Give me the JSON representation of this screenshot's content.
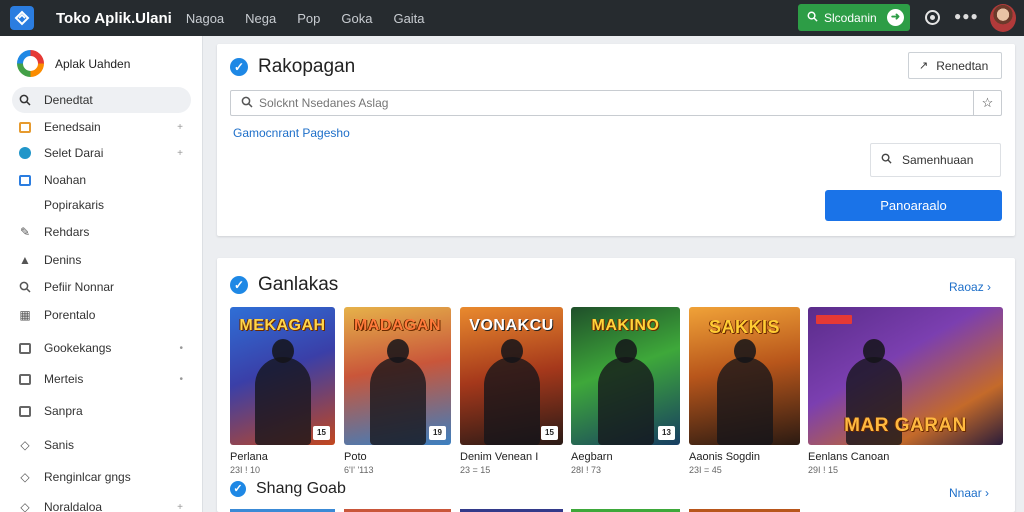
{
  "app": {
    "title": "Toko Aplik.Ulani"
  },
  "topnav": [
    "Nagoa",
    "Nega",
    "Pop",
    "Goka",
    "Gaita"
  ],
  "top_search_label": "Slcodanin",
  "sidebar": {
    "brand": "Aplak Uahden",
    "items": [
      {
        "label": "Denedtat",
        "icon": "search-icon"
      },
      {
        "label": "Eenedsain",
        "icon": "folder-icon",
        "trail": "+"
      },
      {
        "label": "Selet Darai",
        "icon": "circle-icon",
        "trail": "+"
      },
      {
        "label": "Noahan",
        "icon": "grid-icon"
      },
      {
        "label": "Popirakaris",
        "icon": ""
      },
      {
        "label": "Rehdars",
        "icon": "wrench-icon"
      },
      {
        "label": "Denins",
        "icon": "bell-icon"
      },
      {
        "label": "Pefiir Nonnar",
        "icon": "search-icon"
      },
      {
        "label": "Porentalo",
        "icon": "grid-icon"
      },
      {
        "label": "Gookekangs",
        "icon": "calendar-icon",
        "trail": "•"
      },
      {
        "label": "Merteis",
        "icon": "window-icon",
        "trail": "•"
      },
      {
        "label": "Sanpra",
        "icon": "image-icon"
      },
      {
        "label": "Sanis",
        "icon": "chat-icon"
      },
      {
        "label": "Renginlcar gngs",
        "icon": "chat-icon"
      },
      {
        "label": "Noraldaloa",
        "icon": "chat-icon",
        "trail": "+"
      }
    ]
  },
  "search_card": {
    "title": "Rakopagan",
    "header_button": "Renedtan",
    "search_placeholder": "Solcknt Nsedanes Aslag",
    "link": "Gamocnrant Pagesho",
    "secondary_button": "Samenhuaan",
    "primary_button": "Panoaraalo"
  },
  "games_card": {
    "title": "Ganlakas",
    "see_more": "Raoaz",
    "items": [
      {
        "title_art": "MEKAGAH",
        "name": "Perlana",
        "meta": "23I ! 10",
        "rating": "15"
      },
      {
        "title_art": "MADAGAN",
        "name": "Poto",
        "meta": "6'I' '113",
        "rating": "19"
      },
      {
        "title_art": "VONAKCU",
        "name": "Denim Venean I",
        "meta": "23 = 15",
        "rating": "15"
      },
      {
        "title_art": "MAKINO",
        "name": "Aegbarn",
        "meta": "28I ! 73",
        "rating": "13"
      },
      {
        "title_art": "SAKKIS",
        "name": "Aaonis Sogdin",
        "meta": "23I = 45",
        "rating": ""
      },
      {
        "title_art": "MAR GARAN",
        "name": "Eenlans Canoan",
        "meta": "29I ! 15",
        "rating": ""
      }
    ]
  },
  "second_section": {
    "title": "Shang Goab",
    "see_more": "Nnaar"
  },
  "colors": {
    "topbar": "#262b2f",
    "primary": "#1a73e8",
    "search_green": "#2d9d46",
    "accent_blue": "#1e88e5"
  }
}
